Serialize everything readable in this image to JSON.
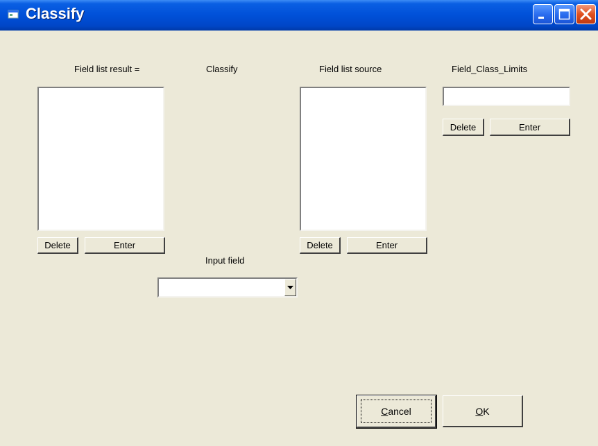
{
  "window": {
    "title": "Classify",
    "controls": [
      "minimize-icon",
      "maximize-icon",
      "close-icon"
    ]
  },
  "labels": {
    "field_list_result": "Field list result =",
    "classify": "Classify",
    "field_list_source": "Field list source",
    "field_class_limits": "Field_Class_Limits",
    "input_field": "Input field"
  },
  "result_panel": {
    "items": [],
    "delete_label": "Delete",
    "enter_label": "Enter"
  },
  "source_panel": {
    "items": [],
    "delete_label": "Delete",
    "enter_label": "Enter"
  },
  "limits_panel": {
    "value": "",
    "delete_label": "Delete",
    "enter_label": "Enter"
  },
  "input_field": {
    "selected": ""
  },
  "footer": {
    "cancel_mnemonic": "C",
    "cancel_rest": "ancel",
    "ok_mnemonic": "O",
    "ok_rest": "K"
  },
  "colors": {
    "dialog_bg": "#ece9d8",
    "titlebar": "#0050d8",
    "close_button": "#e1501f"
  }
}
